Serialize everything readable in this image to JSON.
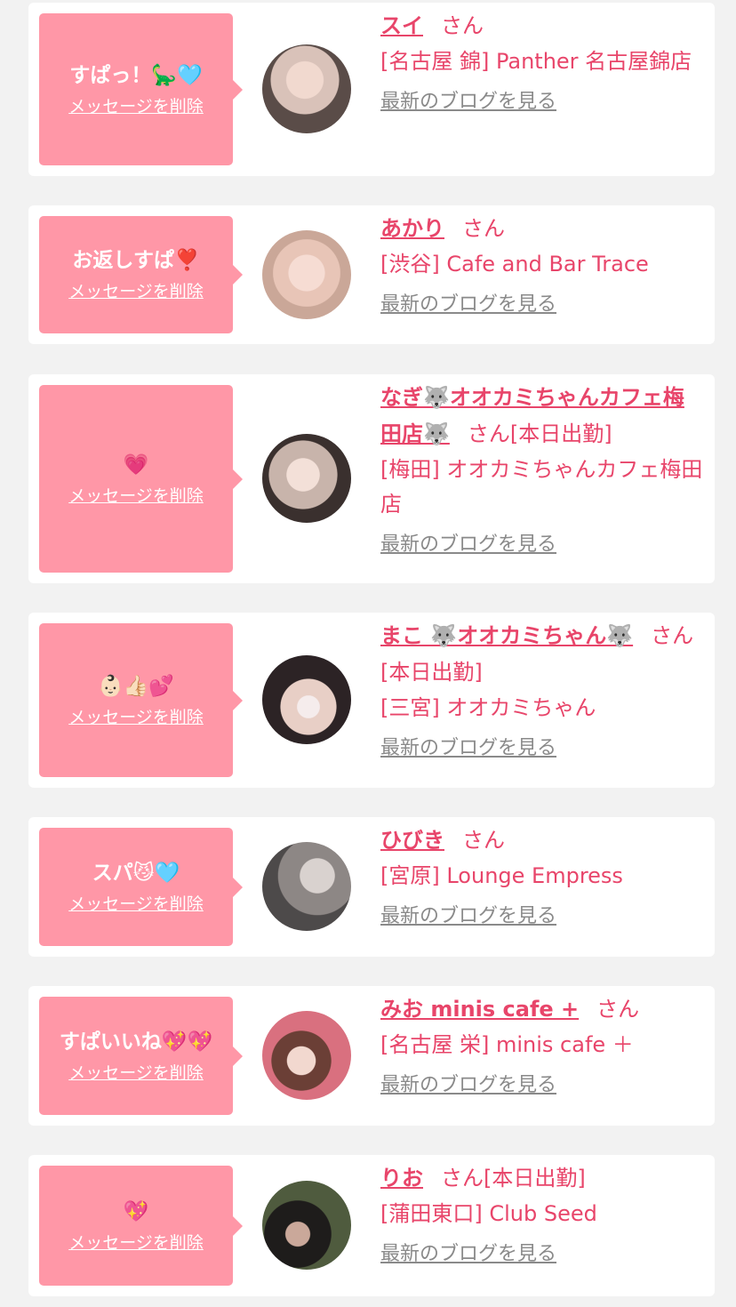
{
  "delete_label": "メッセージを削除",
  "blog_label": "最新のブログを見る",
  "cards": [
    {
      "message": "すぱっ！🦕🩵",
      "name": "スイ",
      "san": "さん",
      "shop": "[名古屋 錦] Panther 名古屋錦店"
    },
    {
      "message": "お返しすぱ❣️",
      "name": "あかり",
      "san": "さん",
      "shop": "[渋谷] Cafe and Bar Trace"
    },
    {
      "message": "💗",
      "name": "なぎ🐺オオカミちゃんカフェ梅田店🐺",
      "san": "さん[本日出勤]",
      "shop": "[梅田] オオカミちゃんカフェ梅田店"
    },
    {
      "message": "👶🏻👍🏻💕",
      "name": "まこ 🐺オオカミちゃん🐺",
      "san": "さん[本日出勤]",
      "shop": "[三宮] オオカミちゃん"
    },
    {
      "message": "スパ😼🩵",
      "name": "ひびき",
      "san": "さん",
      "shop": "[宮原] Lounge Empress"
    },
    {
      "message": "すぱいいね💖💖",
      "name": "みお minis cafe +",
      "san": "さん",
      "shop": "[名古屋 栄] minis cafe ＋"
    },
    {
      "message": "💖",
      "name": "りお",
      "san": "さん[本日出勤]",
      "shop": "[蒲田東口] Club Seed"
    }
  ]
}
